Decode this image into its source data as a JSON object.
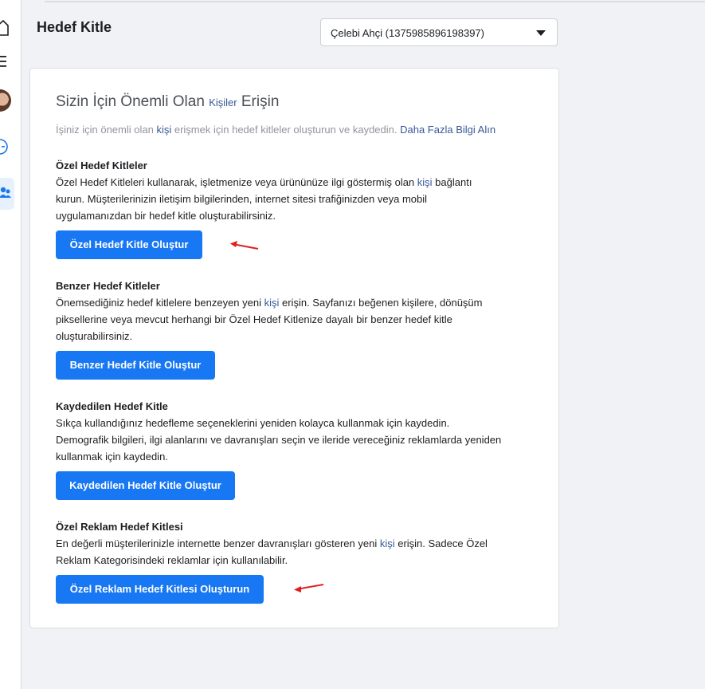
{
  "page": {
    "title": "Hedef Kitle"
  },
  "account_select": {
    "value": "Çelebi Ahçi (1375985896198397)"
  },
  "card": {
    "title_part1": "Sizin İçin Önemli Olan ",
    "title_link": "Kişiler",
    "title_part2": " Erişin",
    "sub_part1": "İşiniz için önemli olan ",
    "sub_link": "kişi",
    "sub_part2": " erişmek için hedef kitleler oluşturun ve kaydedin. ",
    "sub_learn_more": "Daha Fazla Bilgi Alın"
  },
  "sections": [
    {
      "title": "Özel Hedef Kitleler",
      "line1_a": "Özel Hedef Kitleleri kullanarak, işletmenize veya ürününüze ilgi göstermiş olan ",
      "line1_link": "kişi",
      "line1_b": " bağlantı",
      "line2": "kurun. Müşterilerinizin iletişim bilgilerinden, internet sitesi trafiğinizden veya mobil",
      "line3": "uygulamanızdan bir hedef kitle oluşturabilirsiniz.",
      "button": "Özel Hedef Kitle Oluştur"
    },
    {
      "title": "Benzer Hedef Kitleler",
      "line1_a": "Önemsediğiniz hedef kitlelere benzeyen yeni ",
      "line1_link": "kişi",
      "line1_b": " erişin. Sayfanızı beğenen kişilere, dönüşüm",
      "line2": "piksellerine veya mevcut herhangi bir Özel Hedef Kitlenize dayalı bir benzer hedef kitle",
      "line3": "oluşturabilirsiniz.",
      "button": "Benzer Hedef Kitle Oluştur"
    },
    {
      "title": "Kaydedilen Hedef Kitle",
      "line1": "Sıkça kullandığınız hedefleme seçeneklerini yeniden kolayca kullanmak için kaydedin.",
      "line2": "Demografik bilgileri, ilgi alanlarını ve davranışları seçin ve ileride vereceğiniz reklamlarda yeniden",
      "line3": "kullanmak için kaydedin.",
      "button": "Kaydedilen Hedef Kitle Oluştur"
    },
    {
      "title": "Özel Reklam Hedef Kitlesi",
      "line1_a": "En değerli müşterilerinizle internette benzer davranışları gösteren yeni ",
      "line1_link": "kişi",
      "line1_b": " erişin. Sadece Özel",
      "line2": "Reklam Kategorisindeki reklamlar için kullanılabilir.",
      "button": "Özel Reklam Hedef Kitlesi Oluşturun"
    }
  ],
  "sidebar_icons": [
    "home-icon",
    "menu-icon",
    "avatar",
    "circle-icon",
    "audience-icon"
  ],
  "colors": {
    "primary_button": "#1877f2",
    "link": "#385898",
    "annotation_arrow": "#e02020"
  }
}
